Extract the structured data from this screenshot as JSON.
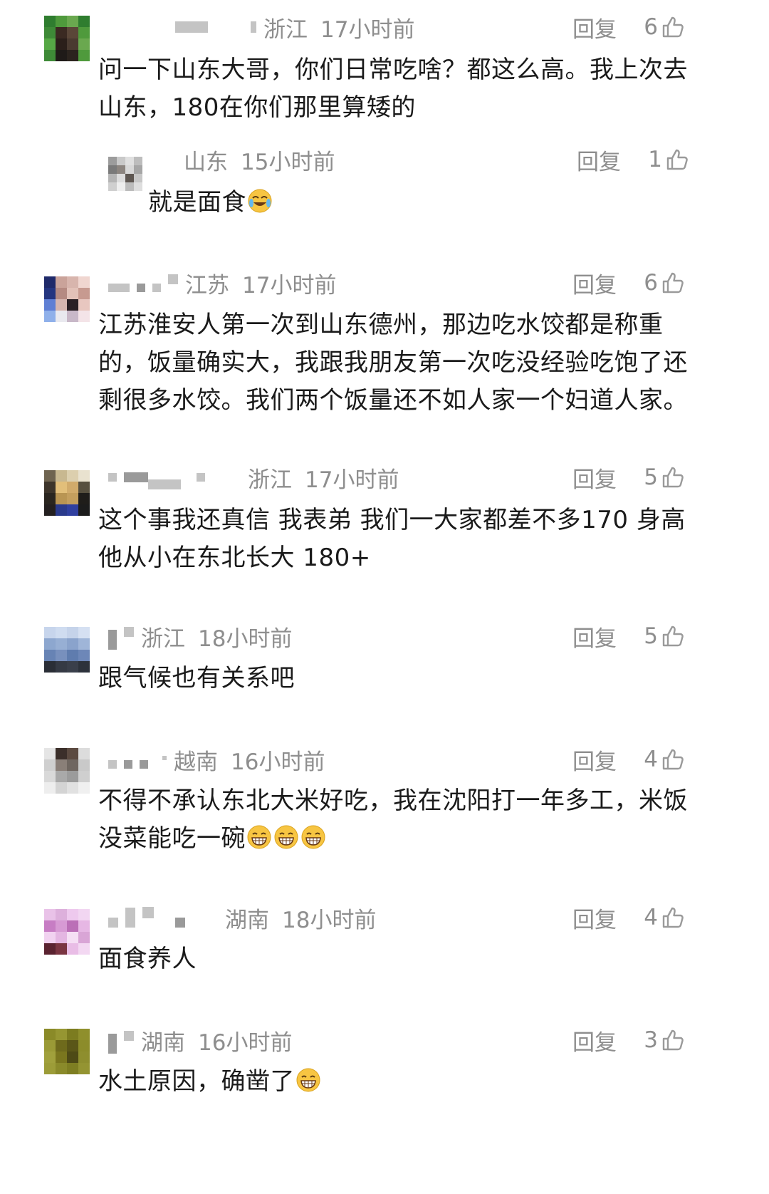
{
  "reply_label": "回复",
  "comments": [
    {
      "location": "浙江",
      "time": "17小时前",
      "likes": "6",
      "text_lines": [
        "问一下山东大哥，你们日常吃啥？都这么高。我上次去",
        "山东，180在你们那里算矮的"
      ],
      "avatar_colors": [
        "#2f7d2f",
        "#4f9a3c",
        "#6aa84f",
        "#2f7d2f",
        "#3e8a37",
        "#3b2a22",
        "#5a4638",
        "#4f9a3c",
        "#56a845",
        "#2b1f1a",
        "#4a3a30",
        "#6aa84f",
        "#3e8a37",
        "#1f1a18",
        "#2b231e",
        "#4f9a3c"
      ],
      "replies": [
        {
          "location": "山东",
          "time": "15小时前",
          "likes": "1",
          "text": "就是面食",
          "emoji": "crying-laugh",
          "avatar_colors": [
            "#9c9c9c",
            "#c9c9c9",
            "#e0e0e0",
            "#bdbdbd",
            "#7a7a7a",
            "#8c8580",
            "#d8d8d8",
            "#a6a6a6",
            "#b5b5b5",
            "#dcdcdc",
            "#5e5752",
            "#c7c7c7",
            "#cfcfcf",
            "#eeeeee",
            "#bcbcbc",
            "#dedede"
          ]
        }
      ]
    },
    {
      "location": "江苏",
      "time": "17小时前",
      "likes": "6",
      "text_lines": [
        "江苏淮安人第一次到山东德州，那边吃水饺都是称重",
        "的，饭量确实大，我跟我朋友第一次吃没经验吃饱了还",
        "剩很多水饺。我们两个饭量还不如人家一个妇道人家。"
      ],
      "avatar_colors": [
        "#1f2a6a",
        "#caa39a",
        "#d8b5ad",
        "#f0d6d0",
        "#243580",
        "#b58a82",
        "#e2c1b8",
        "#c79a90",
        "#5f7fd4",
        "#d6b6b0",
        "#2a2025",
        "#e8c7c0",
        "#8fb0ea",
        "#e9e9ef",
        "#c8b8c8",
        "#f4e4e8"
      ]
    },
    {
      "location": "浙江",
      "time": "17小时前",
      "likes": "5",
      "text_lines": [
        "这个事我还真信 我表弟 我们一大家都差不多170 身高",
        "他从小在东北长大 180+"
      ],
      "avatar_colors": [
        "#6f6450",
        "#c8b890",
        "#dccfae",
        "#e9e2cf",
        "#3d352b",
        "#e2bf7a",
        "#d1ab6b",
        "#57503f",
        "#2a2620",
        "#b99553",
        "#c49f5e",
        "#1f1d1a",
        "#242020",
        "#2a3a8c",
        "#3040a0",
        "#1c1c1c"
      ]
    },
    {
      "location": "浙江",
      "time": "18小时前",
      "likes": "5",
      "text_lines": [
        "跟气候也有关系吧"
      ],
      "avatar_colors": [
        "#c7d5ec",
        "#cfdcf0",
        "#c5d3ea",
        "#d5e0f2",
        "#8da7cf",
        "#97afd4",
        "#8aa3cc",
        "#9fb5d8",
        "#6783b4",
        "#7890bd",
        "#5f7cae",
        "#6d87b8",
        "#2a2e36",
        "#353a44",
        "#3a3f4a",
        "#2d323b"
      ]
    },
    {
      "location": "越南",
      "time": "16小时前",
      "likes": "4",
      "text_lines": [
        "不得不承认东北大米好吃，我在沈阳打一年多工，米饭",
        "没菜能吃一碗"
      ],
      "emojis": [
        "grin",
        "grin",
        "grin"
      ],
      "avatar_colors": [
        "#e5e5e5",
        "#3b2f2a",
        "#5b4a40",
        "#dcdcdc",
        "#cfcfcf",
        "#8a7f78",
        "#6f6660",
        "#c9c9c9",
        "#d9d9d9",
        "#a9a9a9",
        "#9b9b9b",
        "#cfcfcf",
        "#eeeeee",
        "#d4d4d4",
        "#e1e1e1",
        "#f0f0f0"
      ]
    },
    {
      "location": "湖南",
      "time": "18小时前",
      "likes": "4",
      "text_lines": [
        "面食养人"
      ],
      "avatar_colors": [
        "#e9c2e8",
        "#ddb0dc",
        "#eec9ee",
        "#f2d6f2",
        "#c77dc4",
        "#d79ad4",
        "#bb6fb7",
        "#e6b7e4",
        "#f1d2f0",
        "#e4b6e2",
        "#f5dff4",
        "#d9a5d6",
        "#5a2330",
        "#7a3542",
        "#e9bde6",
        "#f3d8f2"
      ]
    },
    {
      "location": "湖南",
      "time": "16小时前",
      "likes": "3",
      "text_lines": [
        "水土原因，确凿了"
      ],
      "emojis": [
        "grin"
      ],
      "avatar_colors": [
        "#8a8a28",
        "#969632",
        "#7c7c20",
        "#8f8f2c",
        "#9a9a36",
        "#6e6a1c",
        "#5a5618",
        "#8c8c2a",
        "#a0a03c",
        "#7a761e",
        "#4e4a16",
        "#8e8e2e",
        "#9c9c38",
        "#8a8a2a",
        "#7e7e22",
        "#949432"
      ]
    }
  ]
}
